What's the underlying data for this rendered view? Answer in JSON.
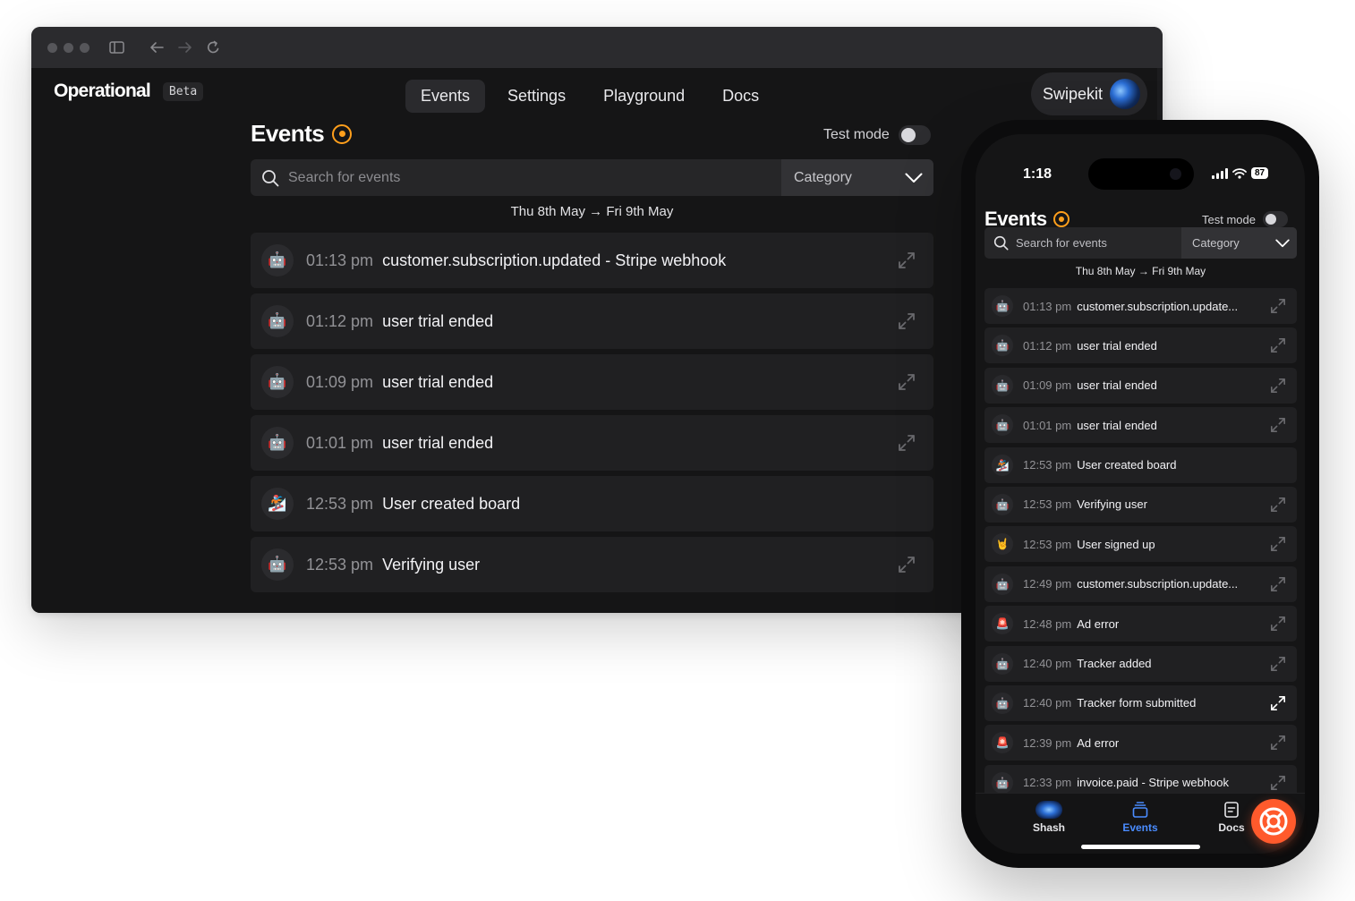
{
  "desktop": {
    "logo": "Operational",
    "beta": "Beta",
    "nav": [
      {
        "label": "Events"
      },
      {
        "label": "Settings"
      },
      {
        "label": "Playground"
      },
      {
        "label": "Docs"
      }
    ],
    "account": "Swipekit",
    "title": "Events",
    "test_mode": "Test mode",
    "search_placeholder": "Search for events",
    "category": "Category",
    "date_range": "Thu 8th May → Fri 9th May",
    "events": [
      {
        "icon": "🤖",
        "time": "01:13 pm",
        "name": "customer.subscription.updated - Stripe webhook",
        "expandable": true
      },
      {
        "icon": "🤖",
        "time": "01:12 pm",
        "name": "user trial ended",
        "expandable": true
      },
      {
        "icon": "🤖",
        "time": "01:09 pm",
        "name": "user trial ended",
        "expandable": true
      },
      {
        "icon": "🤖",
        "time": "01:01 pm",
        "name": "user trial ended",
        "expandable": true
      },
      {
        "icon": "🏂",
        "time": "12:53 pm",
        "name": "User created board",
        "expandable": false
      },
      {
        "icon": "🤖",
        "time": "12:53 pm",
        "name": "Verifying user",
        "expandable": true
      }
    ]
  },
  "mobile": {
    "status_time": "1:18",
    "battery": "87",
    "title": "Events",
    "test_mode": "Test mode",
    "search_placeholder": "Search for events",
    "category": "Category",
    "date_range": "Thu 8th May → Fri 9th May",
    "events": [
      {
        "icon": "🤖",
        "time": "01:13 pm",
        "name": "customer.subscription.update...",
        "expandable": true
      },
      {
        "icon": "🤖",
        "time": "01:12 pm",
        "name": "user trial ended",
        "expandable": true
      },
      {
        "icon": "🤖",
        "time": "01:09 pm",
        "name": "user trial ended",
        "expandable": true
      },
      {
        "icon": "🤖",
        "time": "01:01 pm",
        "name": "user trial ended",
        "expandable": true
      },
      {
        "icon": "🏂",
        "time": "12:53 pm",
        "name": "User created board",
        "expandable": false
      },
      {
        "icon": "🤖",
        "time": "12:53 pm",
        "name": "Verifying user",
        "expandable": true
      },
      {
        "icon": "🤘",
        "time": "12:53 pm",
        "name": "User signed up",
        "expandable": true
      },
      {
        "icon": "🤖",
        "time": "12:49 pm",
        "name": "customer.subscription.update...",
        "expandable": true
      },
      {
        "icon": "🚨",
        "time": "12:48 pm",
        "name": "Ad error",
        "expandable": true
      },
      {
        "icon": "🤖",
        "time": "12:40 pm",
        "name": "Tracker added",
        "expandable": true
      },
      {
        "icon": "🤖",
        "time": "12:40 pm",
        "name": "Tracker form submitted",
        "expandable": true,
        "highlight": true
      },
      {
        "icon": "🚨",
        "time": "12:39 pm",
        "name": "Ad error",
        "expandable": true
      },
      {
        "icon": "🤖",
        "time": "12:33 pm",
        "name": "invoice.paid - Stripe webhook",
        "expandable": true
      }
    ],
    "tabs": [
      {
        "label": "Shash",
        "icon": "avatar"
      },
      {
        "label": "Events",
        "icon": "stack-icon",
        "active": true
      },
      {
        "label": "Docs",
        "icon": "document-icon"
      }
    ]
  },
  "colors": {
    "accent": "#ff9f1c",
    "active_tab": "#4a8cff",
    "help_button": "#ff5a2c"
  }
}
